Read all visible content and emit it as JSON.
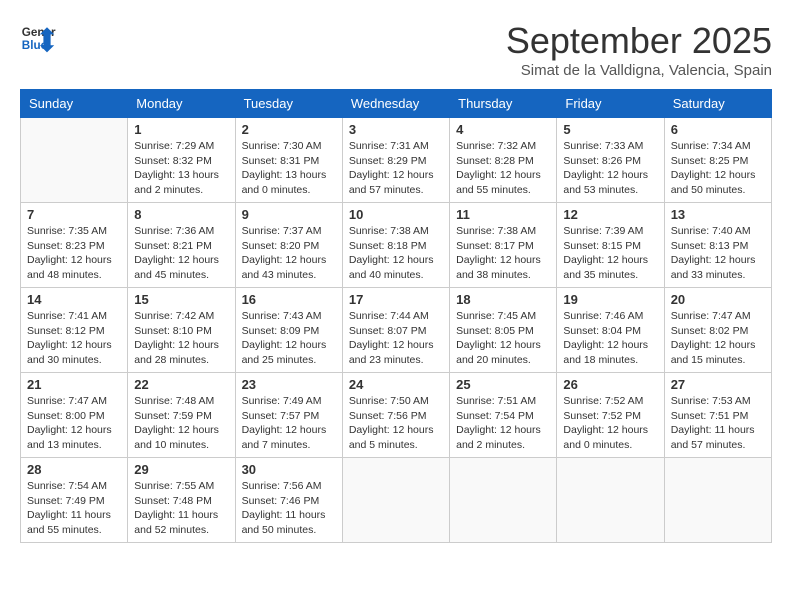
{
  "logo": {
    "line1": "General",
    "line2": "Blue"
  },
  "title": "September 2025",
  "subtitle": "Simat de la Valldigna, Valencia, Spain",
  "days_of_week": [
    "Sunday",
    "Monday",
    "Tuesday",
    "Wednesday",
    "Thursday",
    "Friday",
    "Saturday"
  ],
  "weeks": [
    [
      {
        "day": "",
        "info": ""
      },
      {
        "day": "1",
        "info": "Sunrise: 7:29 AM\nSunset: 8:32 PM\nDaylight: 13 hours\nand 2 minutes."
      },
      {
        "day": "2",
        "info": "Sunrise: 7:30 AM\nSunset: 8:31 PM\nDaylight: 13 hours\nand 0 minutes."
      },
      {
        "day": "3",
        "info": "Sunrise: 7:31 AM\nSunset: 8:29 PM\nDaylight: 12 hours\nand 57 minutes."
      },
      {
        "day": "4",
        "info": "Sunrise: 7:32 AM\nSunset: 8:28 PM\nDaylight: 12 hours\nand 55 minutes."
      },
      {
        "day": "5",
        "info": "Sunrise: 7:33 AM\nSunset: 8:26 PM\nDaylight: 12 hours\nand 53 minutes."
      },
      {
        "day": "6",
        "info": "Sunrise: 7:34 AM\nSunset: 8:25 PM\nDaylight: 12 hours\nand 50 minutes."
      }
    ],
    [
      {
        "day": "7",
        "info": "Sunrise: 7:35 AM\nSunset: 8:23 PM\nDaylight: 12 hours\nand 48 minutes."
      },
      {
        "day": "8",
        "info": "Sunrise: 7:36 AM\nSunset: 8:21 PM\nDaylight: 12 hours\nand 45 minutes."
      },
      {
        "day": "9",
        "info": "Sunrise: 7:37 AM\nSunset: 8:20 PM\nDaylight: 12 hours\nand 43 minutes."
      },
      {
        "day": "10",
        "info": "Sunrise: 7:38 AM\nSunset: 8:18 PM\nDaylight: 12 hours\nand 40 minutes."
      },
      {
        "day": "11",
        "info": "Sunrise: 7:38 AM\nSunset: 8:17 PM\nDaylight: 12 hours\nand 38 minutes."
      },
      {
        "day": "12",
        "info": "Sunrise: 7:39 AM\nSunset: 8:15 PM\nDaylight: 12 hours\nand 35 minutes."
      },
      {
        "day": "13",
        "info": "Sunrise: 7:40 AM\nSunset: 8:13 PM\nDaylight: 12 hours\nand 33 minutes."
      }
    ],
    [
      {
        "day": "14",
        "info": "Sunrise: 7:41 AM\nSunset: 8:12 PM\nDaylight: 12 hours\nand 30 minutes."
      },
      {
        "day": "15",
        "info": "Sunrise: 7:42 AM\nSunset: 8:10 PM\nDaylight: 12 hours\nand 28 minutes."
      },
      {
        "day": "16",
        "info": "Sunrise: 7:43 AM\nSunset: 8:09 PM\nDaylight: 12 hours\nand 25 minutes."
      },
      {
        "day": "17",
        "info": "Sunrise: 7:44 AM\nSunset: 8:07 PM\nDaylight: 12 hours\nand 23 minutes."
      },
      {
        "day": "18",
        "info": "Sunrise: 7:45 AM\nSunset: 8:05 PM\nDaylight: 12 hours\nand 20 minutes."
      },
      {
        "day": "19",
        "info": "Sunrise: 7:46 AM\nSunset: 8:04 PM\nDaylight: 12 hours\nand 18 minutes."
      },
      {
        "day": "20",
        "info": "Sunrise: 7:47 AM\nSunset: 8:02 PM\nDaylight: 12 hours\nand 15 minutes."
      }
    ],
    [
      {
        "day": "21",
        "info": "Sunrise: 7:47 AM\nSunset: 8:00 PM\nDaylight: 12 hours\nand 13 minutes."
      },
      {
        "day": "22",
        "info": "Sunrise: 7:48 AM\nSunset: 7:59 PM\nDaylight: 12 hours\nand 10 minutes."
      },
      {
        "day": "23",
        "info": "Sunrise: 7:49 AM\nSunset: 7:57 PM\nDaylight: 12 hours\nand 7 minutes."
      },
      {
        "day": "24",
        "info": "Sunrise: 7:50 AM\nSunset: 7:56 PM\nDaylight: 12 hours\nand 5 minutes."
      },
      {
        "day": "25",
        "info": "Sunrise: 7:51 AM\nSunset: 7:54 PM\nDaylight: 12 hours\nand 2 minutes."
      },
      {
        "day": "26",
        "info": "Sunrise: 7:52 AM\nSunset: 7:52 PM\nDaylight: 12 hours\nand 0 minutes."
      },
      {
        "day": "27",
        "info": "Sunrise: 7:53 AM\nSunset: 7:51 PM\nDaylight: 11 hours\nand 57 minutes."
      }
    ],
    [
      {
        "day": "28",
        "info": "Sunrise: 7:54 AM\nSunset: 7:49 PM\nDaylight: 11 hours\nand 55 minutes."
      },
      {
        "day": "29",
        "info": "Sunrise: 7:55 AM\nSunset: 7:48 PM\nDaylight: 11 hours\nand 52 minutes."
      },
      {
        "day": "30",
        "info": "Sunrise: 7:56 AM\nSunset: 7:46 PM\nDaylight: 11 hours\nand 50 minutes."
      },
      {
        "day": "",
        "info": ""
      },
      {
        "day": "",
        "info": ""
      },
      {
        "day": "",
        "info": ""
      },
      {
        "day": "",
        "info": ""
      }
    ]
  ]
}
